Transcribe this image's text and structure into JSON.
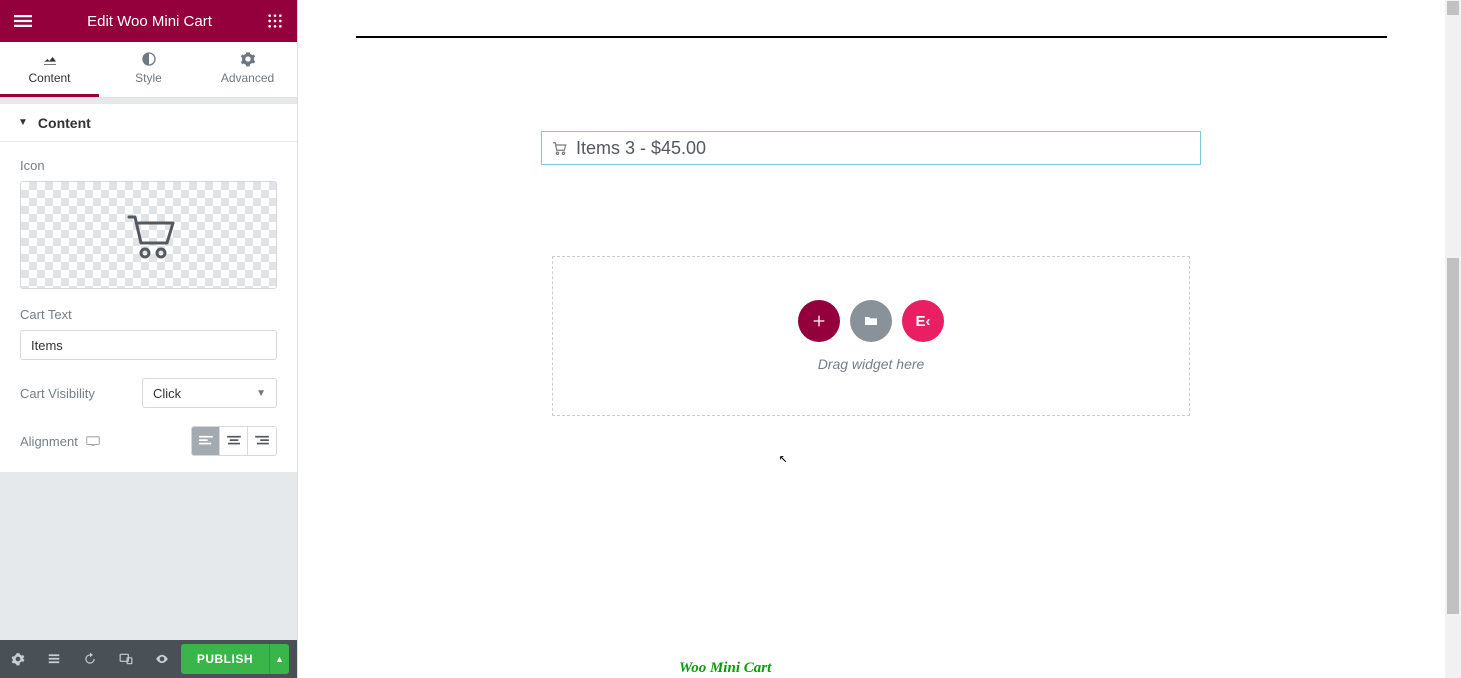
{
  "header": {
    "title": "Edit Woo Mini Cart"
  },
  "tabs": {
    "content": "Content",
    "style": "Style",
    "advanced": "Advanced",
    "active": "content"
  },
  "section": {
    "title": "Content"
  },
  "form": {
    "icon_label": "Icon",
    "cart_text_label": "Cart Text",
    "cart_text_value": "Items",
    "visibility_label": "Cart Visibility",
    "visibility_value": "Click",
    "alignment_label": "Alignment"
  },
  "bottombar": {
    "publish": "PUBLISH"
  },
  "canvas": {
    "cart_line": "Items 3 - $45.00",
    "drop_text": "Drag widget here",
    "ek_label": "E‹"
  },
  "footer": {
    "title": "Woo Mini Cart"
  }
}
